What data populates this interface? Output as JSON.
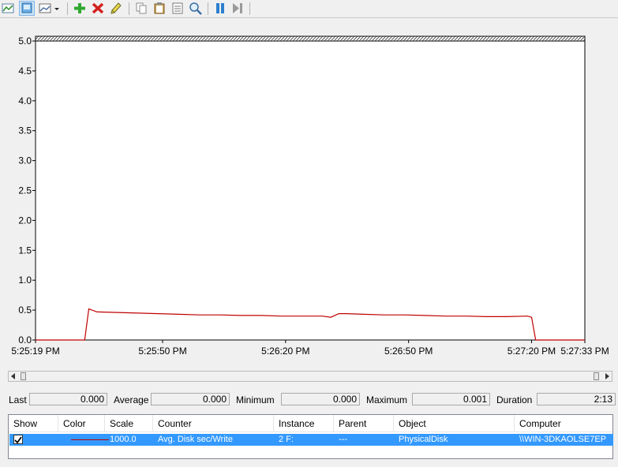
{
  "toolbar": {
    "buttons": [
      {
        "name": "change-graph-type-icon"
      },
      {
        "name": "view-current-activity-icon"
      },
      {
        "name": "change-graph-type-dropdown-icon"
      },
      {
        "name": "add-counter-icon"
      },
      {
        "name": "delete-counter-icon"
      },
      {
        "name": "highlight-icon"
      },
      {
        "name": "copy-properties-icon"
      },
      {
        "name": "paste-counter-list-icon"
      },
      {
        "name": "properties-icon"
      },
      {
        "name": "zoom-icon"
      },
      {
        "name": "freeze-display-icon"
      },
      {
        "name": "update-data-icon"
      }
    ]
  },
  "chart_data": {
    "type": "line",
    "title": "",
    "xlabel": "",
    "ylabel": "",
    "ylim": [
      0,
      5
    ],
    "yticks": [
      "0.0",
      "0.5",
      "1.0",
      "1.5",
      "2.0",
      "2.5",
      "3.0",
      "3.5",
      "4.0",
      "4.5",
      "5.0"
    ],
    "xticks": [
      "5:25:19 PM",
      "5:25:50 PM",
      "5:26:20 PM",
      "5:26:50 PM",
      "5:27:20 PM",
      "5:27:33 PM"
    ],
    "grid": false,
    "series": [
      {
        "color": "#c00000",
        "x_seconds_from_start": [
          0,
          4,
          12,
          13,
          15,
          20,
          25,
          30,
          35,
          40,
          45,
          50,
          55,
          60,
          65,
          70,
          72,
          74,
          76,
          80,
          85,
          90,
          95,
          100,
          105,
          110,
          115,
          120,
          121,
          122,
          134
        ],
        "values": [
          0,
          0,
          0,
          0.52,
          0.47,
          0.46,
          0.45,
          0.44,
          0.43,
          0.42,
          0.42,
          0.41,
          0.41,
          0.4,
          0.4,
          0.4,
          0.38,
          0.44,
          0.44,
          0.43,
          0.42,
          0.42,
          0.41,
          0.4,
          0.4,
          0.39,
          0.39,
          0.4,
          0.38,
          0,
          0
        ]
      }
    ]
  },
  "stats": {
    "last_label": "Last",
    "last_value": "0.000",
    "average_label": "Average",
    "average_value": "0.000",
    "minimum_label": "Minimum",
    "minimum_value": "0.000",
    "maximum_label": "Maximum",
    "maximum_value": "0.001",
    "duration_label": "Duration",
    "duration_value": "2:13"
  },
  "table": {
    "headers": {
      "show": "Show",
      "color": "Color",
      "scale": "Scale",
      "counter": "Counter",
      "instance": "Instance",
      "parent": "Parent",
      "object": "Object",
      "computer": "Computer"
    },
    "row": {
      "show_checked": true,
      "line_color": "#c00000",
      "scale": "1000.0",
      "counter": "Avg. Disk sec/Write",
      "instance": "2 F:",
      "parent": "---",
      "object": "PhysicalDisk",
      "computer": "\\\\WIN-3DKAOLSE7EP"
    },
    "selection_color": "#3399ff"
  }
}
